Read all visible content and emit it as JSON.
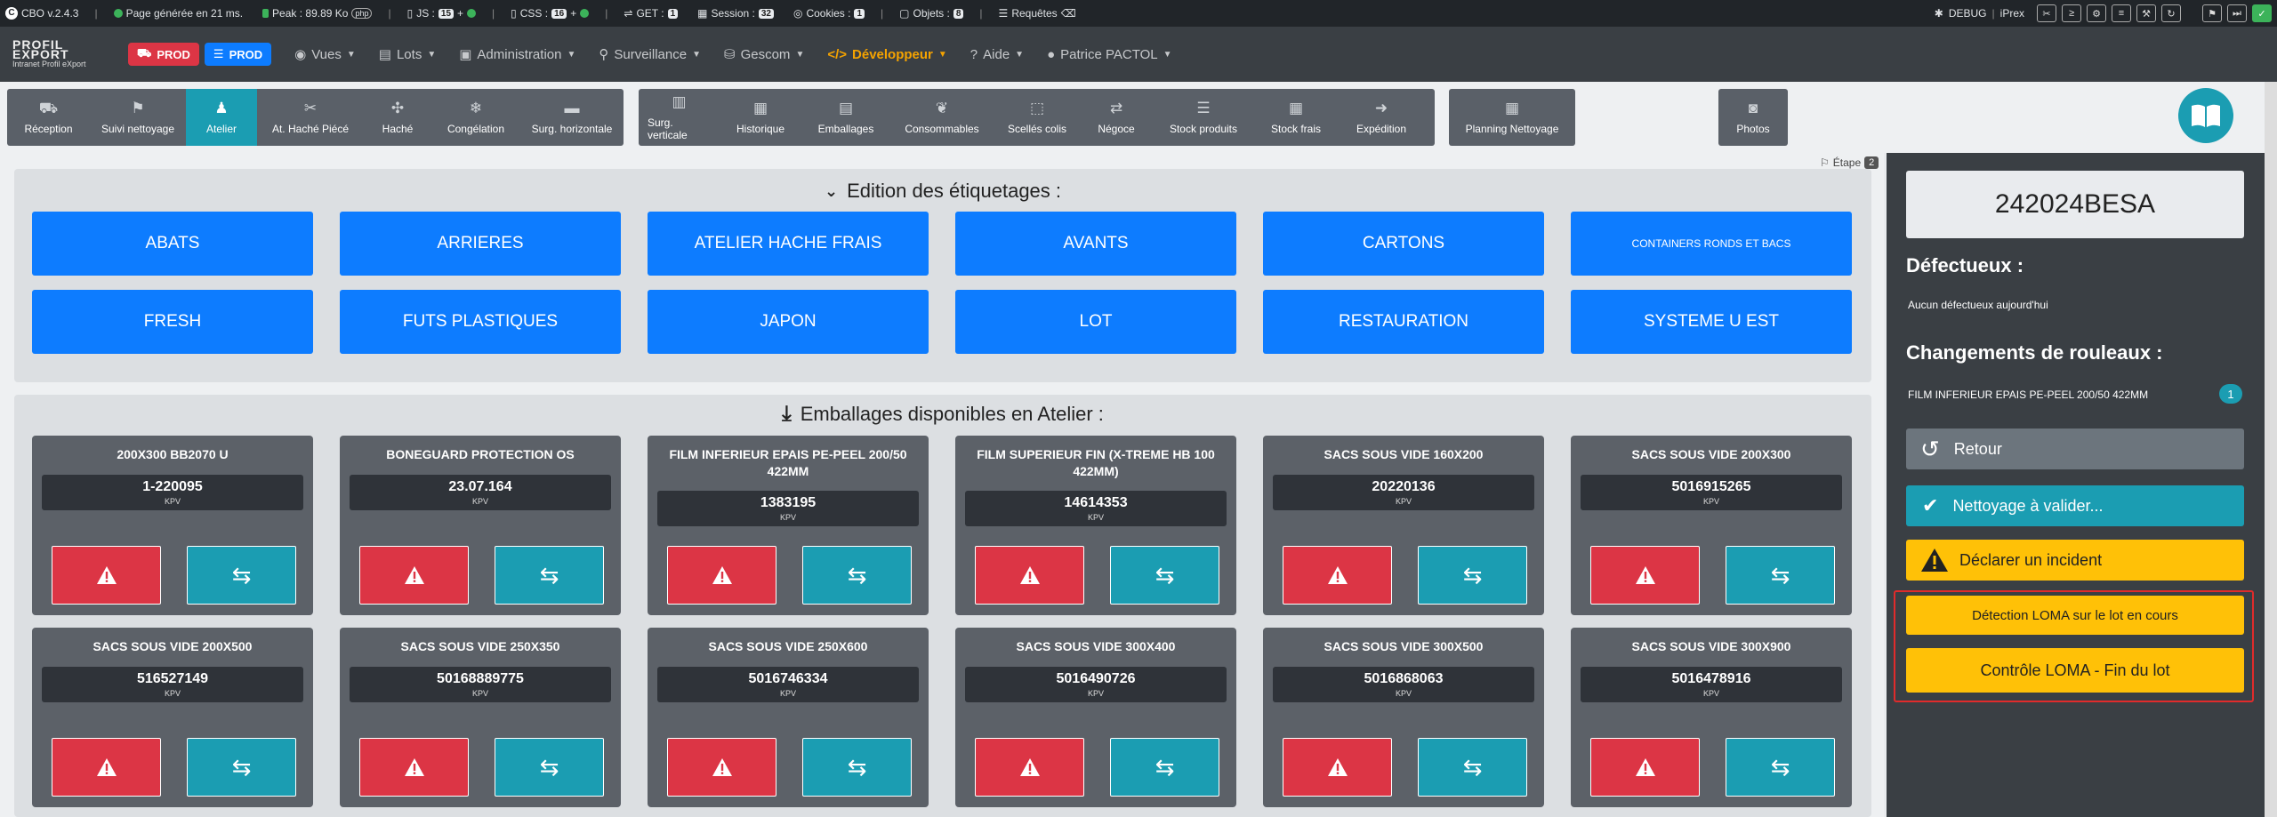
{
  "debugbar": {
    "version": "CBO v.2.4.3",
    "page_time": "Page générée en 21 ms.",
    "peak": "Peak : 89.89 Ko",
    "php": "php",
    "js_label": "JS :",
    "js_count": "15",
    "css_label": "CSS :",
    "css_count": "16",
    "get_label": "GET :",
    "get_count": "1",
    "session_label": "Session :",
    "session_count": "32",
    "cookies_label": "Cookies :",
    "cookies_count": "1",
    "objets_label": "Objets :",
    "objets_count": "8",
    "requetes_label": "Requêtes",
    "debug_label": "DEBUG",
    "debug_user": "iPrex"
  },
  "navbar": {
    "logo_line1": "PROFIL EXPORT",
    "logo_line2": "Intranet Profil eXport",
    "env1": "PROD",
    "env2": "PROD",
    "menu": [
      "Vues",
      "Lots",
      "Administration",
      "Surveillance",
      "Gescom",
      "Développeur",
      "Aide"
    ],
    "user": "Patrice PACTOL"
  },
  "toolbar": {
    "group1": [
      "Réception",
      "Suivi nettoyage",
      "Atelier",
      "At. Haché Piécé",
      "Haché",
      "Congélation",
      "Surg. horizontale"
    ],
    "group2": [
      "Surg. verticale",
      "Historique",
      "Emballages",
      "Consommables",
      "Scellés colis",
      "Négoce",
      "Stock produits",
      "Stock frais",
      "Expédition"
    ],
    "group3": [
      "Planning Nettoyage"
    ],
    "group4": [
      "Photos"
    ],
    "active": "Atelier"
  },
  "step": {
    "label": "Étape",
    "number": "2"
  },
  "etiquetages": {
    "title": "Edition des étiquetages :",
    "buttons": [
      "ABATS",
      "ARRIERES",
      "ATELIER HACHE FRAIS",
      "AVANTS",
      "CARTONS",
      "CONTAINERS RONDS ET BACS",
      "FRESH",
      "FUTS PLASTIQUES",
      "JAPON",
      "LOT",
      "RESTAURATION",
      "SYSTEME U EST"
    ]
  },
  "emballages": {
    "title": "Emballages disponibles en Atelier :",
    "unit": "KPV",
    "items": [
      {
        "name": "200X300 BB2070 U",
        "value": "1-220095"
      },
      {
        "name": "BONEGUARD PROTECTION OS",
        "value": "23.07.164"
      },
      {
        "name": "FILM INFERIEUR EPAIS PE-PEEL 200/50 422MM",
        "value": "1383195"
      },
      {
        "name": "FILM SUPERIEUR FIN (X-TREME HB 100 422MM)",
        "value": "14614353"
      },
      {
        "name": "SACS SOUS VIDE 160X200",
        "value": "20220136"
      },
      {
        "name": "SACS SOUS VIDE 200X300",
        "value": "5016915265"
      },
      {
        "name": "SACS SOUS VIDE 200X500",
        "value": "516527149"
      },
      {
        "name": "SACS SOUS VIDE 250X350",
        "value": "50168889775"
      },
      {
        "name": "SACS SOUS VIDE 250X600",
        "value": "5016746334"
      },
      {
        "name": "SACS SOUS VIDE 300X400",
        "value": "5016490726"
      },
      {
        "name": "SACS SOUS VIDE 300X500",
        "value": "5016868063"
      },
      {
        "name": "SACS SOUS VIDE 300X900",
        "value": "5016478916"
      }
    ]
  },
  "sidebar": {
    "lot": "242024BESA",
    "defectueux_title": "Défectueux :",
    "defectueux_text": "Aucun défectueux aujourd'hui",
    "rouleaux_title": "Changements de rouleaux :",
    "rouleaux_item": "FILM INFERIEUR EPAIS PE-PEEL 200/50 422MM",
    "rouleaux_count": "1",
    "retour": "Retour",
    "nettoyage": "Nettoyage à valider...",
    "incident": "Déclarer un incident",
    "loma_detection": "Détection LOMA sur le lot en cours",
    "loma_controle": "Contrôle LOMA - Fin du lot"
  },
  "colors": {
    "primary": "#0d7cff",
    "info": "#1b9db2",
    "danger": "#dc3545",
    "warning": "#ffc107",
    "accent": "#f5a300"
  }
}
